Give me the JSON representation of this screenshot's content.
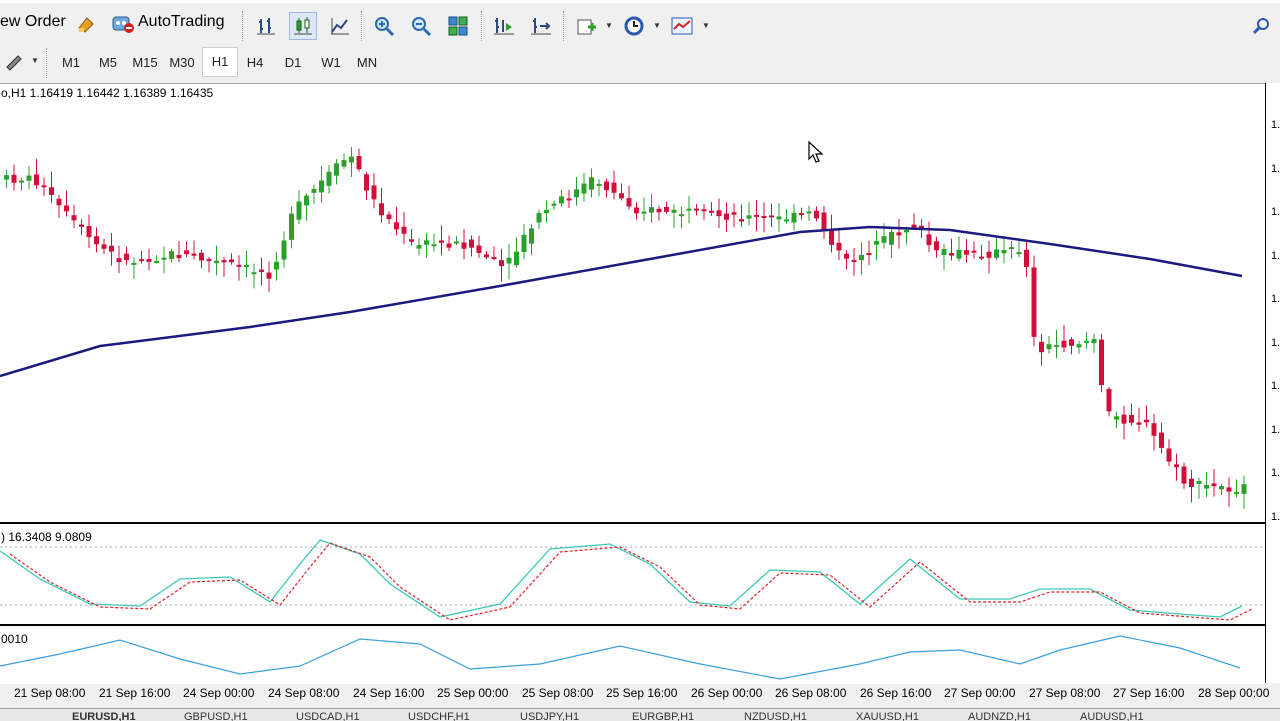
{
  "toolbar": {
    "new_order_label": "ew Order",
    "autotrading_label": "AutoTrading"
  },
  "timeframes": [
    "M1",
    "M5",
    "M15",
    "M30",
    "H1",
    "H4",
    "D1",
    "W1",
    "MN"
  ],
  "active_timeframe": "H1",
  "chart": {
    "header": "o,H1  1.16419 1.16442 1.16389 1.16435",
    "stoch_label": ") 16.3408 9.0809",
    "osc_label": "0010",
    "stoch_levels": [
      "10",
      "80",
      "20",
      "0"
    ],
    "date_labels": [
      "21 Sep 08:00",
      "21 Sep 16:00",
      "24 Sep 00:00",
      "24 Sep 08:00",
      "24 Sep 16:00",
      "25 Sep 00:00",
      "25 Sep 08:00",
      "25 Sep 16:00",
      "26 Sep 00:00",
      "26 Sep 08:00",
      "26 Sep 16:00",
      "27 Sep 00:00",
      "27 Sep 08:00",
      "27 Sep 16:00",
      "28 Sep 00:00"
    ],
    "bull_color": "#2ca02c",
    "bear_color": "#d0103a",
    "ma_color": "#1a1a80",
    "stoch_main_color": "#3cc8b4",
    "stoch_signal_color": "#e02020",
    "osc_color": "#3aa0dc"
  },
  "price_axis_ticks": [
    "1.",
    "1.",
    "1.",
    "1.",
    "1.",
    "1.",
    "1.",
    "1.",
    "1.",
    "1."
  ],
  "tabs": [
    "EURUSD,H1",
    "GBPUSD,H1",
    "USDCAD,H1",
    "USDCHF,H1",
    "USDJPY,H1",
    "EURGBP,H1",
    "NZDUSD,H1",
    "XAUUSD,H1",
    "AUDNZD,H1",
    "AUDUSD,H1"
  ]
}
